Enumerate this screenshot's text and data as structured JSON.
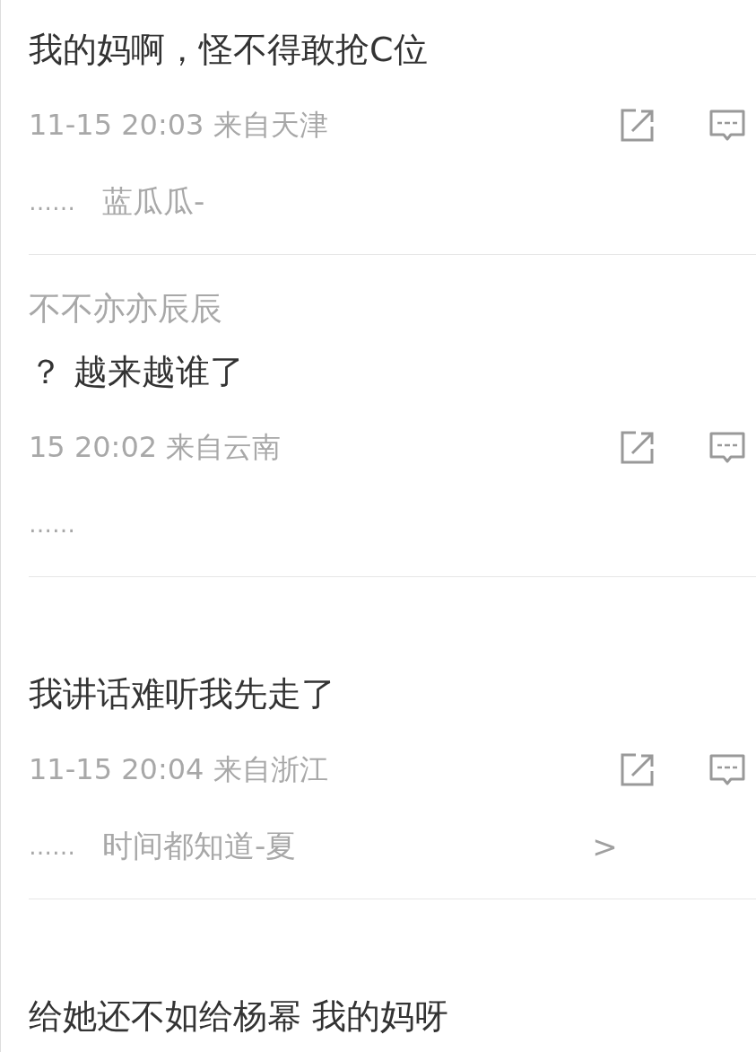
{
  "comments": [
    {
      "content": "我的妈啊，怪不得敢抢C位",
      "time": "11-15 20:03 来自天津",
      "song": {
        "dots": "……",
        "title": "蓝瓜瓜-"
      }
    },
    {
      "name": "不不亦亦辰辰",
      "content": "？ 越来越谁了",
      "time": "15 20:02 来自云南",
      "song": {
        "dots": "……"
      }
    },
    {
      "content": "我讲话难听我先走了",
      "time": "11-15 20:04 来自浙江",
      "song": {
        "dots": "……",
        "title": "时间都知道-夏",
        "arrow": ">"
      }
    },
    {
      "content": "给她还不如给杨幂 我的妈呀"
    }
  ]
}
